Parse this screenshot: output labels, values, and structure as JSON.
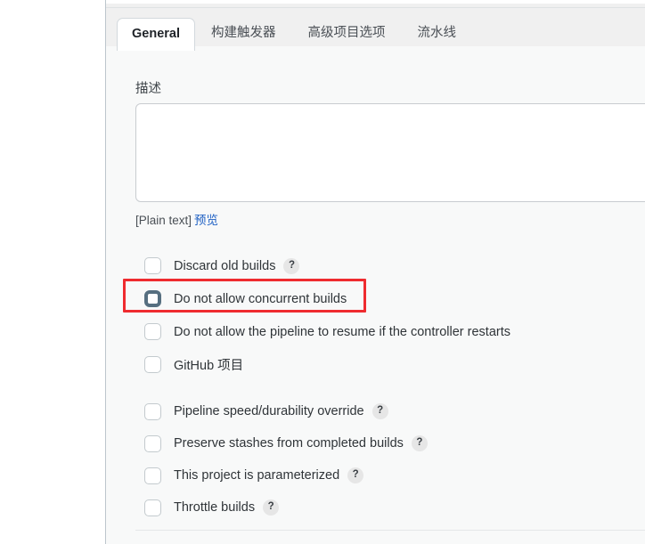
{
  "tabs": [
    {
      "label": "General",
      "active": true
    },
    {
      "label": "构建触发器",
      "active": false
    },
    {
      "label": "高级项目选项",
      "active": false
    },
    {
      "label": "流水线",
      "active": false
    }
  ],
  "description": {
    "label": "描述",
    "value": "",
    "placeholder": "",
    "markup_note": "[Plain text]",
    "preview_link": "预览"
  },
  "checkbox_groups": [
    {
      "name": "build-options",
      "items": [
        {
          "label": "Discard old builds",
          "checked": false,
          "focused": false,
          "help": "?"
        },
        {
          "label": "Do not allow concurrent builds",
          "checked": false,
          "focused": true,
          "help": null
        },
        {
          "label": "Do not allow the pipeline to resume if the controller restarts",
          "checked": false,
          "focused": false,
          "help": null
        },
        {
          "label": "GitHub 项目",
          "checked": false,
          "focused": false,
          "help": null
        }
      ]
    },
    {
      "name": "advanced-options",
      "items": [
        {
          "label": "Pipeline speed/durability override",
          "checked": false,
          "focused": false,
          "help": "?"
        },
        {
          "label": "Preserve stashes from completed builds",
          "checked": false,
          "focused": false,
          "help": "?"
        },
        {
          "label": "This project is parameterized",
          "checked": false,
          "focused": false,
          "help": "?"
        },
        {
          "label": "Throttle builds",
          "checked": false,
          "focused": false,
          "help": "?"
        }
      ]
    }
  ],
  "annotation": {
    "type": "red-rectangle-highlight",
    "target_label": "Do not allow concurrent builds",
    "color": "#ef2b2f"
  },
  "colors": {
    "tabbar_background": "#f0f0f0",
    "form_background": "#f8f9f9",
    "active_tab_background": "#ffffff",
    "link": "#1f61c4",
    "checkbox_focus_border": "#566f80",
    "checkbox_border": "#c3cace",
    "annotation_red": "#ef2b2f",
    "text": "#2f3438"
  }
}
